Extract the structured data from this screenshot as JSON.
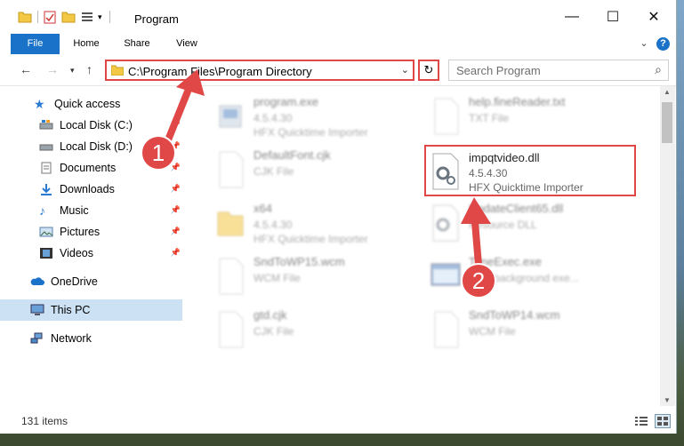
{
  "window": {
    "title": "Program",
    "controls": {
      "minimize": "—",
      "maximize": "☐",
      "close": "✕"
    }
  },
  "ribbon": {
    "tabs": [
      "File",
      "Home",
      "Share",
      "View"
    ],
    "expand": "⌄",
    "help": "?"
  },
  "address": {
    "path": "C:\\Program Files\\Program Directory",
    "search_placeholder": "Search Program"
  },
  "sidebar": {
    "items": [
      {
        "label": "Quick access",
        "icon": "star-icon",
        "pinned": false
      },
      {
        "label": "Local Disk (C:)",
        "icon": "drive-icon",
        "pinned": true
      },
      {
        "label": "Local Disk (D:)",
        "icon": "drive-icon",
        "pinned": true
      },
      {
        "label": "Documents",
        "icon": "documents-icon",
        "pinned": true
      },
      {
        "label": "Downloads",
        "icon": "download-icon",
        "pinned": true
      },
      {
        "label": "Music",
        "icon": "music-icon",
        "pinned": true
      },
      {
        "label": "Pictures",
        "icon": "pictures-icon",
        "pinned": true
      },
      {
        "label": "Videos",
        "icon": "videos-icon",
        "pinned": true
      },
      {
        "label": "OneDrive",
        "icon": "cloud-icon",
        "pinned": false
      },
      {
        "label": "This PC",
        "icon": "computer-icon",
        "pinned": false,
        "selected": true
      },
      {
        "label": "Network",
        "icon": "network-icon",
        "pinned": false
      }
    ]
  },
  "files": [
    {
      "name": "program.exe",
      "line2": "4.5.4.30",
      "line3": "HFX Quicktime Importer",
      "icon": "exe-icon"
    },
    {
      "name": "help.fineReader.txt",
      "line2": "TXT File",
      "line3": "",
      "icon": "text-file-icon"
    },
    {
      "name": "DefaultFont.cjk",
      "line2": "CJK File",
      "line3": "",
      "icon": "file-icon"
    },
    {
      "name": "impqtvideo.dll",
      "line2": "4.5.4.30",
      "line3": "HFX Quicktime Importer",
      "icon": "dll-gear-icon",
      "highlighted": true
    },
    {
      "name": "x64",
      "line2": "4.5.4.30",
      "line3": "HFX Quicktime Importer",
      "icon": "folder-icon"
    },
    {
      "name": "UpdateClient65.dll",
      "line2": "Resource DLL",
      "line3": "",
      "icon": "dll-gear-icon"
    },
    {
      "name": "SndToWP15.wcm",
      "line2": "WCM File",
      "line3": "",
      "icon": "file-icon"
    },
    {
      "name": "TimeExec.exe",
      "line2": "DRY background exe...",
      "line3": "",
      "icon": "window-icon"
    },
    {
      "name": "gtd.cjk",
      "line2": "CJK File",
      "line3": "",
      "icon": "file-icon"
    },
    {
      "name": "SndToWP14.wcm",
      "line2": "WCM File",
      "line3": "",
      "icon": "file-icon"
    }
  ],
  "status": {
    "count": "131 items"
  },
  "annotations": {
    "step1": "1",
    "step2": "2",
    "color": "#e04848"
  }
}
